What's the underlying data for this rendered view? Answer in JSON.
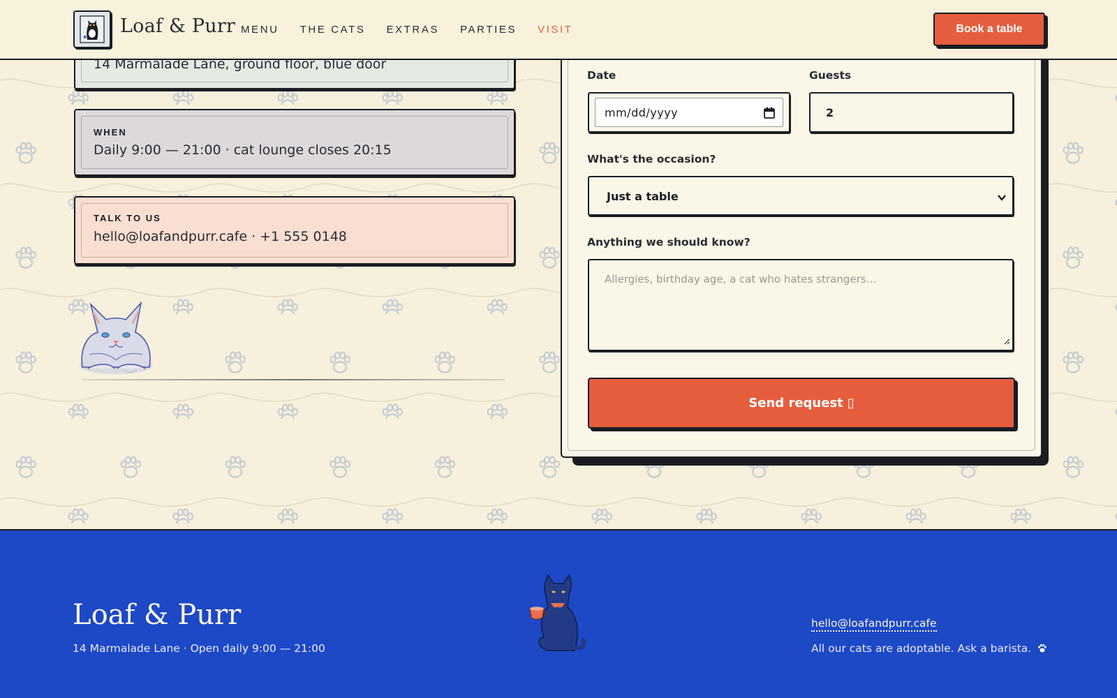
{
  "header": {
    "brand": "Loaf & Purr",
    "nav": [
      "MENU",
      "THE CATS",
      "EXTRAS",
      "PARTIES",
      "VISIT"
    ],
    "active_nav": "VISIT",
    "book_label": "Book a table"
  },
  "info": {
    "where_value": "14 Marmalade Lane, ground floor, blue door",
    "when_label": "WHEN",
    "when_value": "Daily 9:00 — 21:00 · cat lounge closes 20:15",
    "talk_label": "TALK TO US",
    "talk_value": "hello@loafandpurr.cafe · +1 555 0148"
  },
  "form": {
    "date_label": "Date",
    "date_placeholder": "mm/dd/yyyy",
    "guests_label": "Guests",
    "guests_value": "2",
    "occasion_label": "What's the occasion?",
    "occasion_value": "Just a table",
    "notes_label": "Anything we should know?",
    "notes_placeholder": "Allergies, birthday age, a cat who hates strangers…",
    "send_label": "Send request",
    "send_glyph": "▯"
  },
  "footer": {
    "brand": "Loaf & Purr",
    "address": "14 Marmalade Lane · Open daily 9:00 — 21:00",
    "email": "hello@loafandpurr.cafe",
    "note": "All our cats are adoptable. Ask a barista."
  },
  "colors": {
    "accent": "#e65d3e",
    "ink": "#1c1c22",
    "cream": "#f6f0dc",
    "footer_blue": "#1d48c6"
  },
  "icons": [
    "cat-logo-icon",
    "calendar-icon",
    "chevron-down-icon",
    "paw-icon",
    "grey-cat-illustration",
    "black-cat-with-teacup-illustration",
    "paw-print-icon"
  ]
}
